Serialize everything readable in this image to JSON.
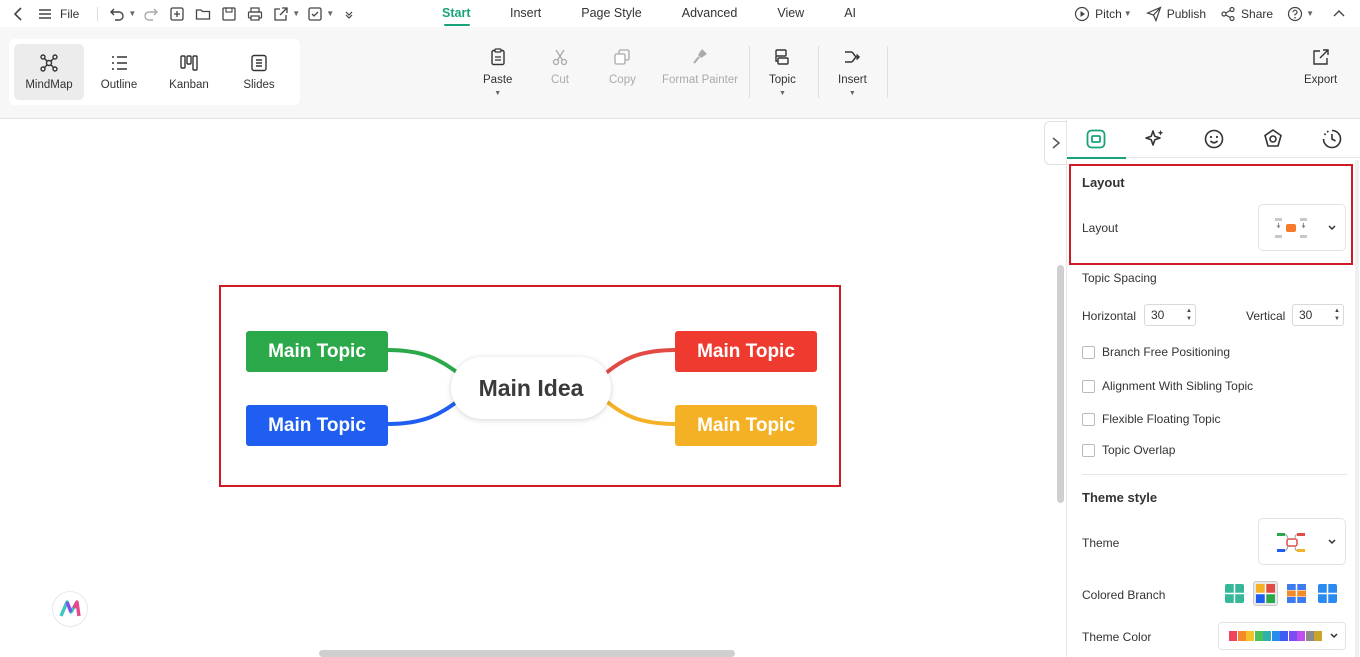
{
  "topbar": {
    "file_label": "File",
    "tabs": [
      "Start",
      "Insert",
      "Page Style",
      "Advanced",
      "View",
      "AI"
    ],
    "active_tab": "Start",
    "pitch": "Pitch",
    "publish": "Publish",
    "share": "Share"
  },
  "toolbar": {
    "views": [
      {
        "label": "MindMap",
        "icon": "mindmap-icon"
      },
      {
        "label": "Outline",
        "icon": "outline-icon"
      },
      {
        "label": "Kanban",
        "icon": "kanban-icon"
      },
      {
        "label": "Slides",
        "icon": "slides-icon"
      }
    ],
    "paste": "Paste",
    "cut": "Cut",
    "copy": "Copy",
    "format_painter": "Format Painter",
    "topic": "Topic",
    "insert": "Insert",
    "export": "Export"
  },
  "mindmap": {
    "central": "Main Idea",
    "topics": [
      {
        "label": "Main Topic",
        "color": "#2ba84a"
      },
      {
        "label": "Main Topic",
        "color": "#1f5ef0"
      },
      {
        "label": "Main Topic",
        "color": "#ef3a2f"
      },
      {
        "label": "Main Topic",
        "color": "#f4b125"
      }
    ]
  },
  "panel": {
    "layout_section": "Layout",
    "layout_label": "Layout",
    "topic_spacing": "Topic Spacing",
    "horizontal_label": "Horizontal",
    "horizontal_value": "30",
    "vertical_label": "Vertical",
    "vertical_value": "30",
    "checkboxes": [
      "Branch Free Positioning",
      "Alignment With Sibling Topic",
      "Flexible Floating Topic",
      "Topic Overlap"
    ],
    "theme_style": "Theme style",
    "theme_label": "Theme",
    "colored_branch": "Colored Branch",
    "theme_color": "Theme Color",
    "theme_color_palette": [
      "#f0445a",
      "#f58a2b",
      "#f5c22b",
      "#4cc35a",
      "#2fb0a8",
      "#2b8af0",
      "#3d5ef0",
      "#7a4ef0",
      "#c04ef0",
      "#8a8a8a",
      "#c9a52b",
      "#58b85a",
      "#a33ad8"
    ]
  },
  "colors": {
    "accent": "#1aa37a",
    "highlight": "#d01b24"
  }
}
